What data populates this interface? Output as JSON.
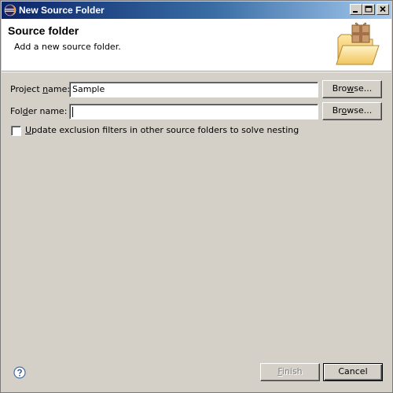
{
  "window": {
    "title": "New Source Folder",
    "icon": "eclipse-icon"
  },
  "banner": {
    "title": "Source folder",
    "description": "Add a new source folder.",
    "image": "folder-package-icon"
  },
  "form": {
    "project_label_prefix": "Project ",
    "project_label_mnemonic": "n",
    "project_label_suffix": "ame:",
    "project_value": "Sample",
    "folder_label_prefix": "Fol",
    "folder_label_mnemonic": "d",
    "folder_label_suffix": "er name:",
    "folder_value": "",
    "browse_project_prefix": "Bro",
    "browse_project_mnemonic": "w",
    "browse_project_suffix": "se...",
    "browse_folder_prefix": "Br",
    "browse_folder_mnemonic": "o",
    "browse_folder_suffix": "wse...",
    "checkbox_mnemonic": "U",
    "checkbox_label_rest": "pdate exclusion filters in other source folders to solve nesting",
    "checkbox_checked": false
  },
  "footer": {
    "help_icon": "help-icon",
    "finish_mnemonic": "F",
    "finish_rest": "inish",
    "finish_enabled": false,
    "cancel_label": "Cancel"
  }
}
